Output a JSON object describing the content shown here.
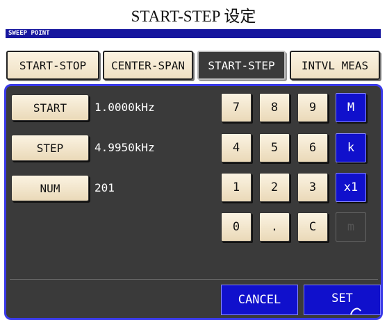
{
  "title": "START-STEP 设定",
  "sweep_label": "SWEEP POINT",
  "tabs": [
    {
      "label": "START-STOP",
      "active": false
    },
    {
      "label": "CENTER-SPAN",
      "active": false
    },
    {
      "label": "START-STEP",
      "active": true
    },
    {
      "label": "INTVL MEAS",
      "active": false
    }
  ],
  "params": [
    {
      "label": "START",
      "value": "1.0000kHz"
    },
    {
      "label": "STEP",
      "value": "4.9950kHz"
    },
    {
      "label": "NUM",
      "value": "201"
    }
  ],
  "keypad": {
    "rows": [
      [
        "7",
        "8",
        "9",
        "M"
      ],
      [
        "4",
        "5",
        "6",
        "k"
      ],
      [
        "1",
        "2",
        "3",
        "x1"
      ],
      [
        "0",
        ".",
        "C",
        "m"
      ]
    ]
  },
  "actions": {
    "cancel": "CANCEL",
    "set": "SET"
  },
  "colors": {
    "accent_blue": "#1010cc",
    "panel_bg": "#3a3a3a",
    "border_blue": "#3a3ae8",
    "sweep_bar": "#16169e"
  }
}
